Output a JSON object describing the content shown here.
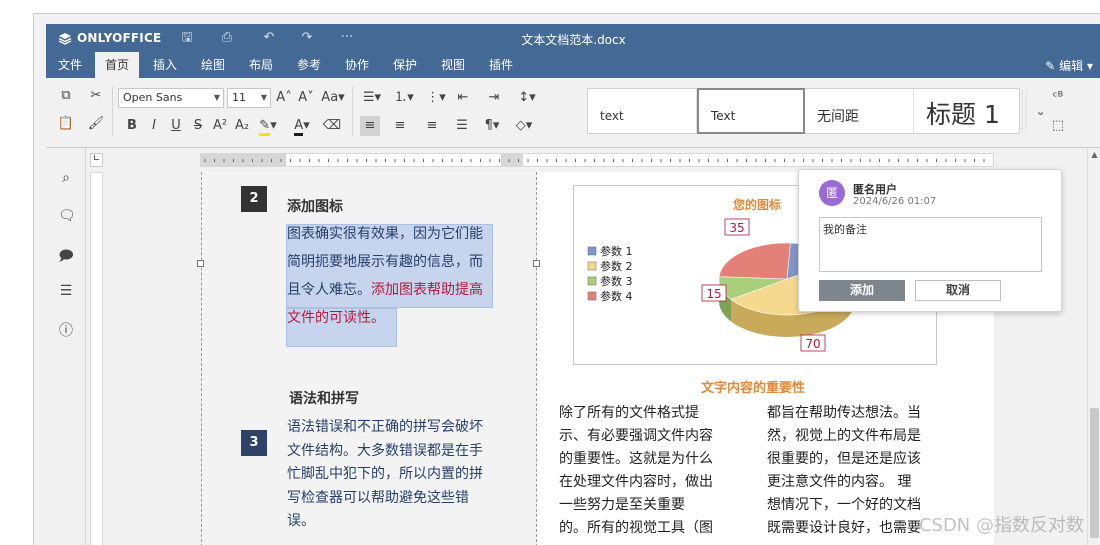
{
  "app": {
    "brand": "ONLYOFFICE",
    "doc_title": "文本文档范本.docx",
    "edit_label": "编辑"
  },
  "menu_tabs": [
    "文件",
    "首页",
    "插入",
    "绘图",
    "布局",
    "参考",
    "协作",
    "保护",
    "视图",
    "插件"
  ],
  "active_tab": "首页",
  "toolbar": {
    "font_name": "Open Sans",
    "font_size": "11",
    "styles": [
      "text",
      "Text",
      "无间距",
      "标题 1"
    ],
    "selected_style": "Text"
  },
  "document": {
    "sections": [
      {
        "number": "2",
        "heading": "添加图标",
        "lines": [
          "图表确实很有效果，因为它们能",
          "简明扼要地展示有趣的信息，而",
          "且令人难忘。"
        ],
        "highlight": "添加图表帮助提高",
        "highlight_end": "文件的可读性。"
      },
      {
        "number": "3",
        "heading": "语法和拼写",
        "lines": [
          "语法错误和不正确的拼写会破坏",
          "文件结构。大多数错误都是在手",
          "忙脚乱中犯下的，所以内置的拼",
          "写检查器可以帮助避免这些错",
          "误。"
        ]
      }
    ],
    "chart_caption": "文字内容的重要性",
    "col_a": [
      "除了所有的文件格式提",
      "示、有必要强调文件内容",
      "的重要性。这就是为什么",
      "在处理文件内容时，做出",
      "一些努力是至关重要",
      "的。所有的视觉工具（图"
    ],
    "col_b": [
      "都旨在帮助传达想法。当",
      "然，视觉上的文件布局是",
      "很重要的，但是还是应该",
      "更注意文件的内容。 理",
      "想情况下，一个好的文档",
      "既需要设计良好，也需要"
    ]
  },
  "chart_data": {
    "type": "pie",
    "title": "您的图标",
    "categories": [
      "参数 1",
      "参数 2",
      "参数 3",
      "参数 4"
    ],
    "values": [
      null,
      70,
      15,
      35
    ],
    "colors": [
      "#7f96c9",
      "#f4d98f",
      "#a9cf7a",
      "#e38078"
    ],
    "legend_position": "left",
    "data_labels": [
      "35",
      "15",
      "70"
    ]
  },
  "comment": {
    "author": "匿名用户",
    "avatar_letter": "匿",
    "date": "2024/6/26 01:07",
    "text": "我的备注",
    "add_label": "添加",
    "cancel_label": "取消"
  },
  "watermark": "CSDN @指数反对数"
}
